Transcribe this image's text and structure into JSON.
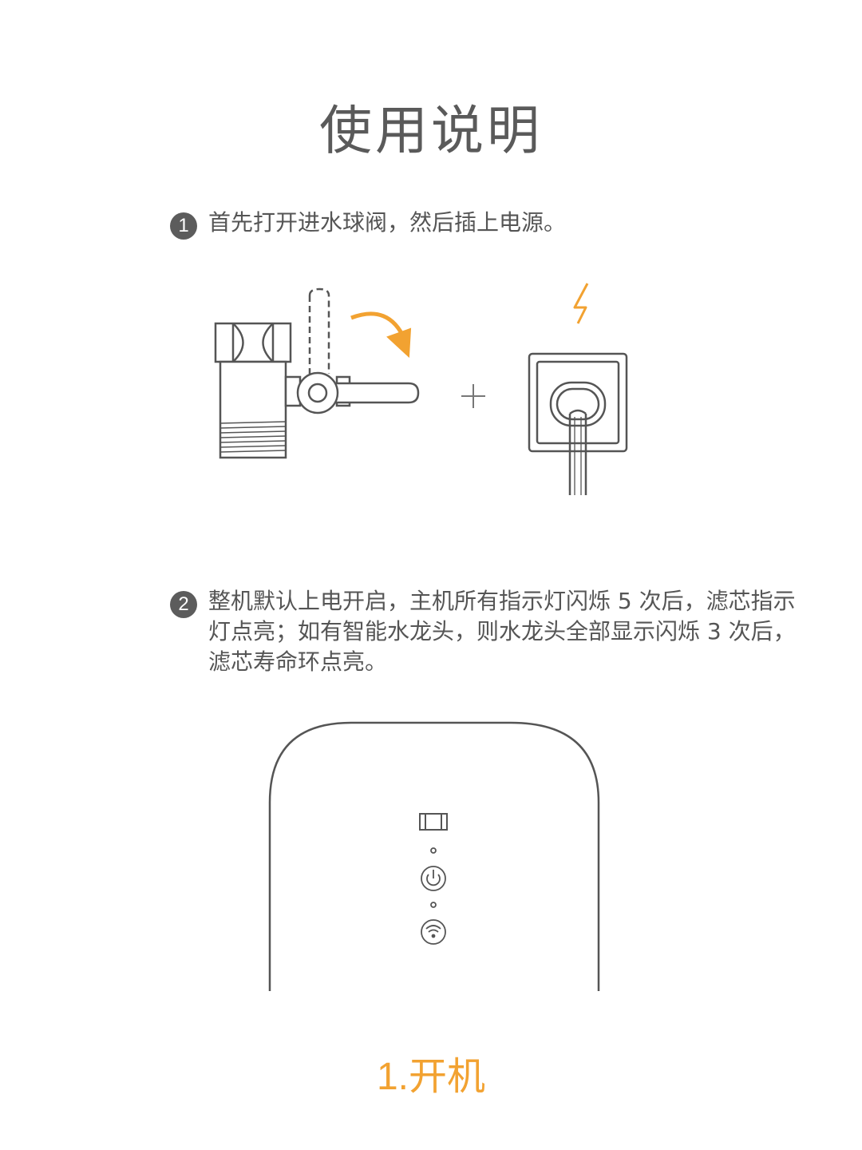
{
  "title": "使用说明",
  "steps": [
    {
      "number": "1",
      "text": "首先打开进水球阀，然后插上电源。"
    },
    {
      "number": "2",
      "text": "整机默认上电开启，主机所有指示灯闪烁 5 次后，滤芯指示灯点亮；如有智能水龙头，则水龙头全部显示闪烁 3 次后，滤芯寿命环点亮。"
    }
  ],
  "illustrations": {
    "valve": {
      "icon": "ball-valve-icon",
      "arrow_color": "#f2a231"
    },
    "plus_sign": "+",
    "socket": {
      "icon": "power-socket-icon",
      "lightning_color": "#f2a231"
    },
    "device": {
      "icons": [
        "filter-indicator-icon",
        "power-icon",
        "wifi-icon"
      ]
    }
  },
  "caption": "1.开机",
  "colors": {
    "accent": "#f2a231",
    "line": "#555555",
    "text": "#555555"
  }
}
